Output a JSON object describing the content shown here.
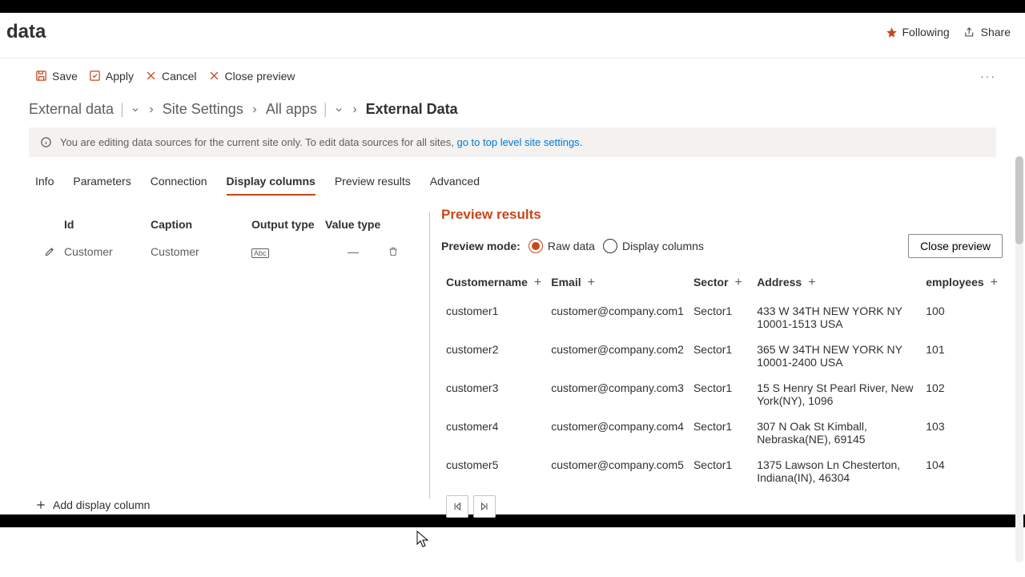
{
  "header": {
    "title": "data",
    "following": "Following",
    "share": "Share"
  },
  "toolbar": {
    "save": "Save",
    "apply": "Apply",
    "cancel": "Cancel",
    "close_preview": "Close preview"
  },
  "breadcrumb": {
    "items": [
      "External data",
      "Site Settings",
      "All apps"
    ],
    "current": "External Data"
  },
  "infobar": {
    "text": "You are editing data sources for the current site only. To edit data sources for all sites, ",
    "link": "go to top level site settings"
  },
  "tabs": [
    "Info",
    "Parameters",
    "Connection",
    "Display columns",
    "Preview results",
    "Advanced"
  ],
  "active_tab": "Display columns",
  "left": {
    "headers": {
      "id": "Id",
      "caption": "Caption",
      "output": "Output type",
      "value": "Value type"
    },
    "rows": [
      {
        "id": "Customer",
        "caption": "Customer",
        "output_badge": "Abc",
        "value": "—"
      }
    ],
    "add": "Add display column"
  },
  "preview": {
    "title": "Preview results",
    "mode_label": "Preview mode:",
    "raw": "Raw data",
    "display": "Display columns",
    "close": "Close preview",
    "columns": [
      "Customername",
      "Email",
      "Sector",
      "Address",
      "employees"
    ],
    "rows": [
      {
        "name": "customer1",
        "email": "customer@company.com1",
        "sector": "Sector1",
        "address": "433 W 34TH NEW YORK NY 10001-1513 USA",
        "employees": "100"
      },
      {
        "name": "customer2",
        "email": "customer@company.com2",
        "sector": "Sector1",
        "address": "365 W 34TH NEW YORK NY 10001-2400 USA",
        "employees": "101"
      },
      {
        "name": "customer3",
        "email": "customer@company.com3",
        "sector": "Sector1",
        "address": "15 S Henry St Pearl River, New York(NY), 1096",
        "employees": "102"
      },
      {
        "name": "customer4",
        "email": "customer@company.com4",
        "sector": "Sector1",
        "address": "307 N Oak St Kimball, Nebraska(NE), 69145",
        "employees": "103"
      },
      {
        "name": "customer5",
        "email": "customer@company.com5",
        "sector": "Sector1",
        "address": "1375 Lawson Ln Chesterton, Indiana(IN), 46304",
        "employees": "104"
      }
    ]
  }
}
